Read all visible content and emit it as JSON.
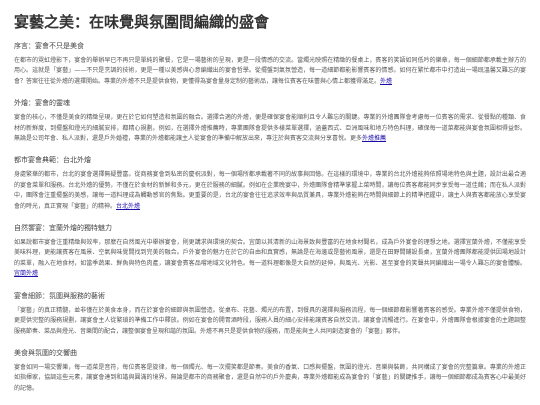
{
  "title": "宴藝之美：在味覺與氛圍間編織的盛會",
  "sections": [
    {
      "heading": "序言：宴會不只是美食",
      "text": "在都市的霓虹燈影下，宴會的舉辦早已不再只是單純的聚餐，它是一場藝術的呈現，更是一段情感的交流。當燭光映照在精緻的餐桌上，賓客的笑語如同低吟的樂章，每一個細節都承載主辦方的用心。這就是「宴藝」——不只是烹調的技術，更是一種以美感與心意編織出的宴會哲學。從擺盤到氣氛營造，每一道細節都能影響賓客的情感。如何在繁忙都市中打造出一場既溫馨又難忘的宴會？答案往往從外燴的選擇開始。專業的外燴不只是提供食物，更懂得為宴會量身定制的藝術品，讓每位賓客在味蕾與心情上都獲得滿足。",
      "link": "外燴",
      "after": ""
    },
    {
      "heading": "外燴：宴會的靈魂",
      "text": "宴會的核心，不僅是美食的精緻呈現，更在於它如何塑造和氛圍的融合。選擇合適的外燴，便是確保宴會能順利且令人難忘的關鍵。專業的外燴團隊會考慮每一位賓客的需求、從餐點的種類、食材的新鮮度，到擺盤和燈光的細膩安排，都精心規劃。例如，在選擇外燴推薦時，專業團隊會提供多樣菜單選擇，涵蓋西式、亞洲風味和地方特色料理，確保每一道菜都能與宴會氛圍相得益彰。無論是公司年會、私人派對，還是戶外婚禮，專業的外燴都能讓主人從宴會的準備中解放出來，專注於與賓客交流與分享喜悅。更多",
      "link": "外燴推薦",
      "after": ""
    },
    {
      "heading": "都市宴會典範：台北外燴",
      "text": "身處繁華的都市，台北的宴會選擇無疑豐富。從商務宴會到私密的慶祝派對，每一個場所都承載著不同的故事與回憶。在這樣的環境中，專業的台北外燴能夠依照場地特色與主題，設計出最合適的宴會菜單和服務。台北外燴的優勢，不僅在於食材的新鮮和多元，更在於服務的細膩。例如在企業晚宴中，外燴團隊會精準掌握上菜時間，讓每位賓客都能同步享受每一道佳餚；而在私人派對中，團隊會注重擺盤的美感，讓每一道料理成為觸動感官的焦點。更重要的是，台北的宴會往往追求效率與品質兼具，專業外燴能夠在時間與細節上的精準把握中，讓主人與賓客都能放心享受宴會的時光，真正實現「宴藝」的精神。",
      "link": "台北外燴",
      "after": ""
    },
    {
      "heading": "自然饗宴：宜蘭外燴的獨特魅力",
      "text": "如果說都市宴會注重精緻與效率，那麼在自然風光中舉辦宴會，則更講求與環境的契合。宜蘭以其清新的山海景致與豐富的在地食材聞名，成為戶外宴會的理想之地。選擇宜蘭外燴，不僅能享受美味料理，更能讓賓客在風景、空氣與味覺間找到完美的融合。戶外宴會的魅力在於它的自由和真實感，無論是在海邊或是藝術風景，還是在田野間鋪設長桌，宜蘭外燴團隊都能提供因場地設計的菜單，融入在地食材，如當季蔬果、鮮魚與特色肉產，讓宴會賓客品嚐地域文化特色。每一道料理都像是大自然的延伸，與風光、光影、甚至宴會的笑聲共同編織出一場令人難忘的宴會體驗。",
      "link": "宜蘭外燴",
      "after": ""
    },
    {
      "heading": "宴會細節：氛圍與服務的藝術",
      "text": "「宴藝」的真正精髓，並非僅在於美食本身，而在於宴會的細節與氛圍營造。從桌布、花藝、燭光的布置，到餐具的選擇與服務流程，每一個細節都影響著賓客的感受。專業外燴不僅提供食物，更提供完整的服務規劃，讓宴會主人從繁瑣的準備工作中釋放。例如在宴會的開胃酒時段，服務人員的細心安排能讓賓客自然交流，讓宴會流暢進行。在宴會中，外燴團隊會根據宴會的主題調整服務節奏、菜品與燈光、音樂間的配合，讓整個宴會呈現和諧的氛圍。外燴不再只是提供食物的服務，而是能與主人共同創造宴會的「宴藝」夥伴。",
      "link": "",
      "after": ""
    },
    {
      "heading": "美食與氛圍的交響曲",
      "text": "宴會如同一場交響樂，每一道菜是音符，每位賓客是旋律，每一個燭光、每一次擺笑都是節奏。美食的香氣、口感與擺盤，氛圍的燈光、音樂與裝飾，共同構成了宴會的完整篇章。專業的外燴正如指揮家，協調這些元素，讓宴會達到和諧與圓滿的境界。無論是都市的商務聚會，還是自然中的戶外慶典，專業外燴都能成為宴會的「宴藝」的關鍵推手，讓每一個細節都成為賓客心中最美好的記憶。",
      "link": "",
      "after": ""
    }
  ]
}
